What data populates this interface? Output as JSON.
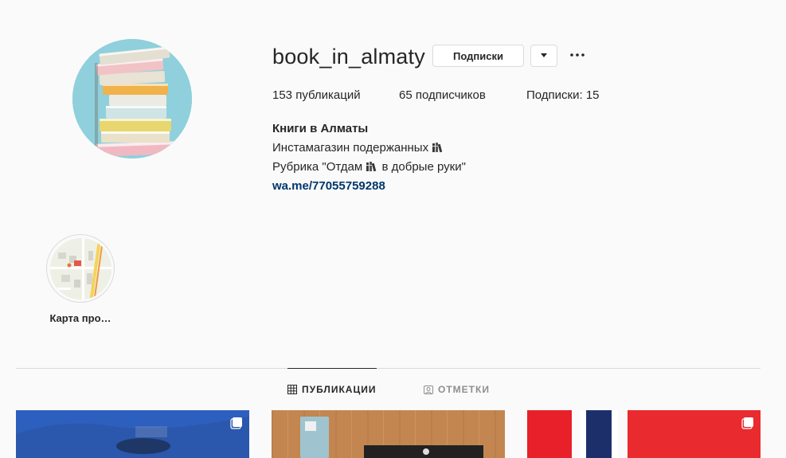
{
  "profile": {
    "username": "book_in_almaty",
    "follow_button": "Подписки",
    "dropdown_icon": "caret-down-icon",
    "more_icon": "more-horizontal-icon",
    "avatar_icon": "book-stack-avatar"
  },
  "stats": {
    "posts_count": "153",
    "posts_label": " публикаций",
    "followers_count": "65",
    "followers_label": " подписчиков",
    "following_label": "Подписки: ",
    "following_count": "15"
  },
  "bio": {
    "name": "Книги в Алматы",
    "line1": "Инстамагазин подержанных",
    "line2_pre": "Рубрика \"Отдам ",
    "line2_post": " в добрые руки\"",
    "link": "wa.me/77055759288",
    "emoji_icon": "books-emoji-icon"
  },
  "highlights": [
    {
      "label": "Карта про…",
      "icon": "map-thumbnail"
    }
  ],
  "tabs": [
    {
      "label": "ПУБЛИКАЦИИ",
      "icon": "grid-icon",
      "active": true
    },
    {
      "label": "ОТМЕТКИ",
      "icon": "tagged-icon",
      "active": false
    }
  ],
  "colors": {
    "background": "#fafafa",
    "text": "#262626",
    "link": "#00376b",
    "muted": "#8e8e8e",
    "border": "#dbdbdb"
  }
}
